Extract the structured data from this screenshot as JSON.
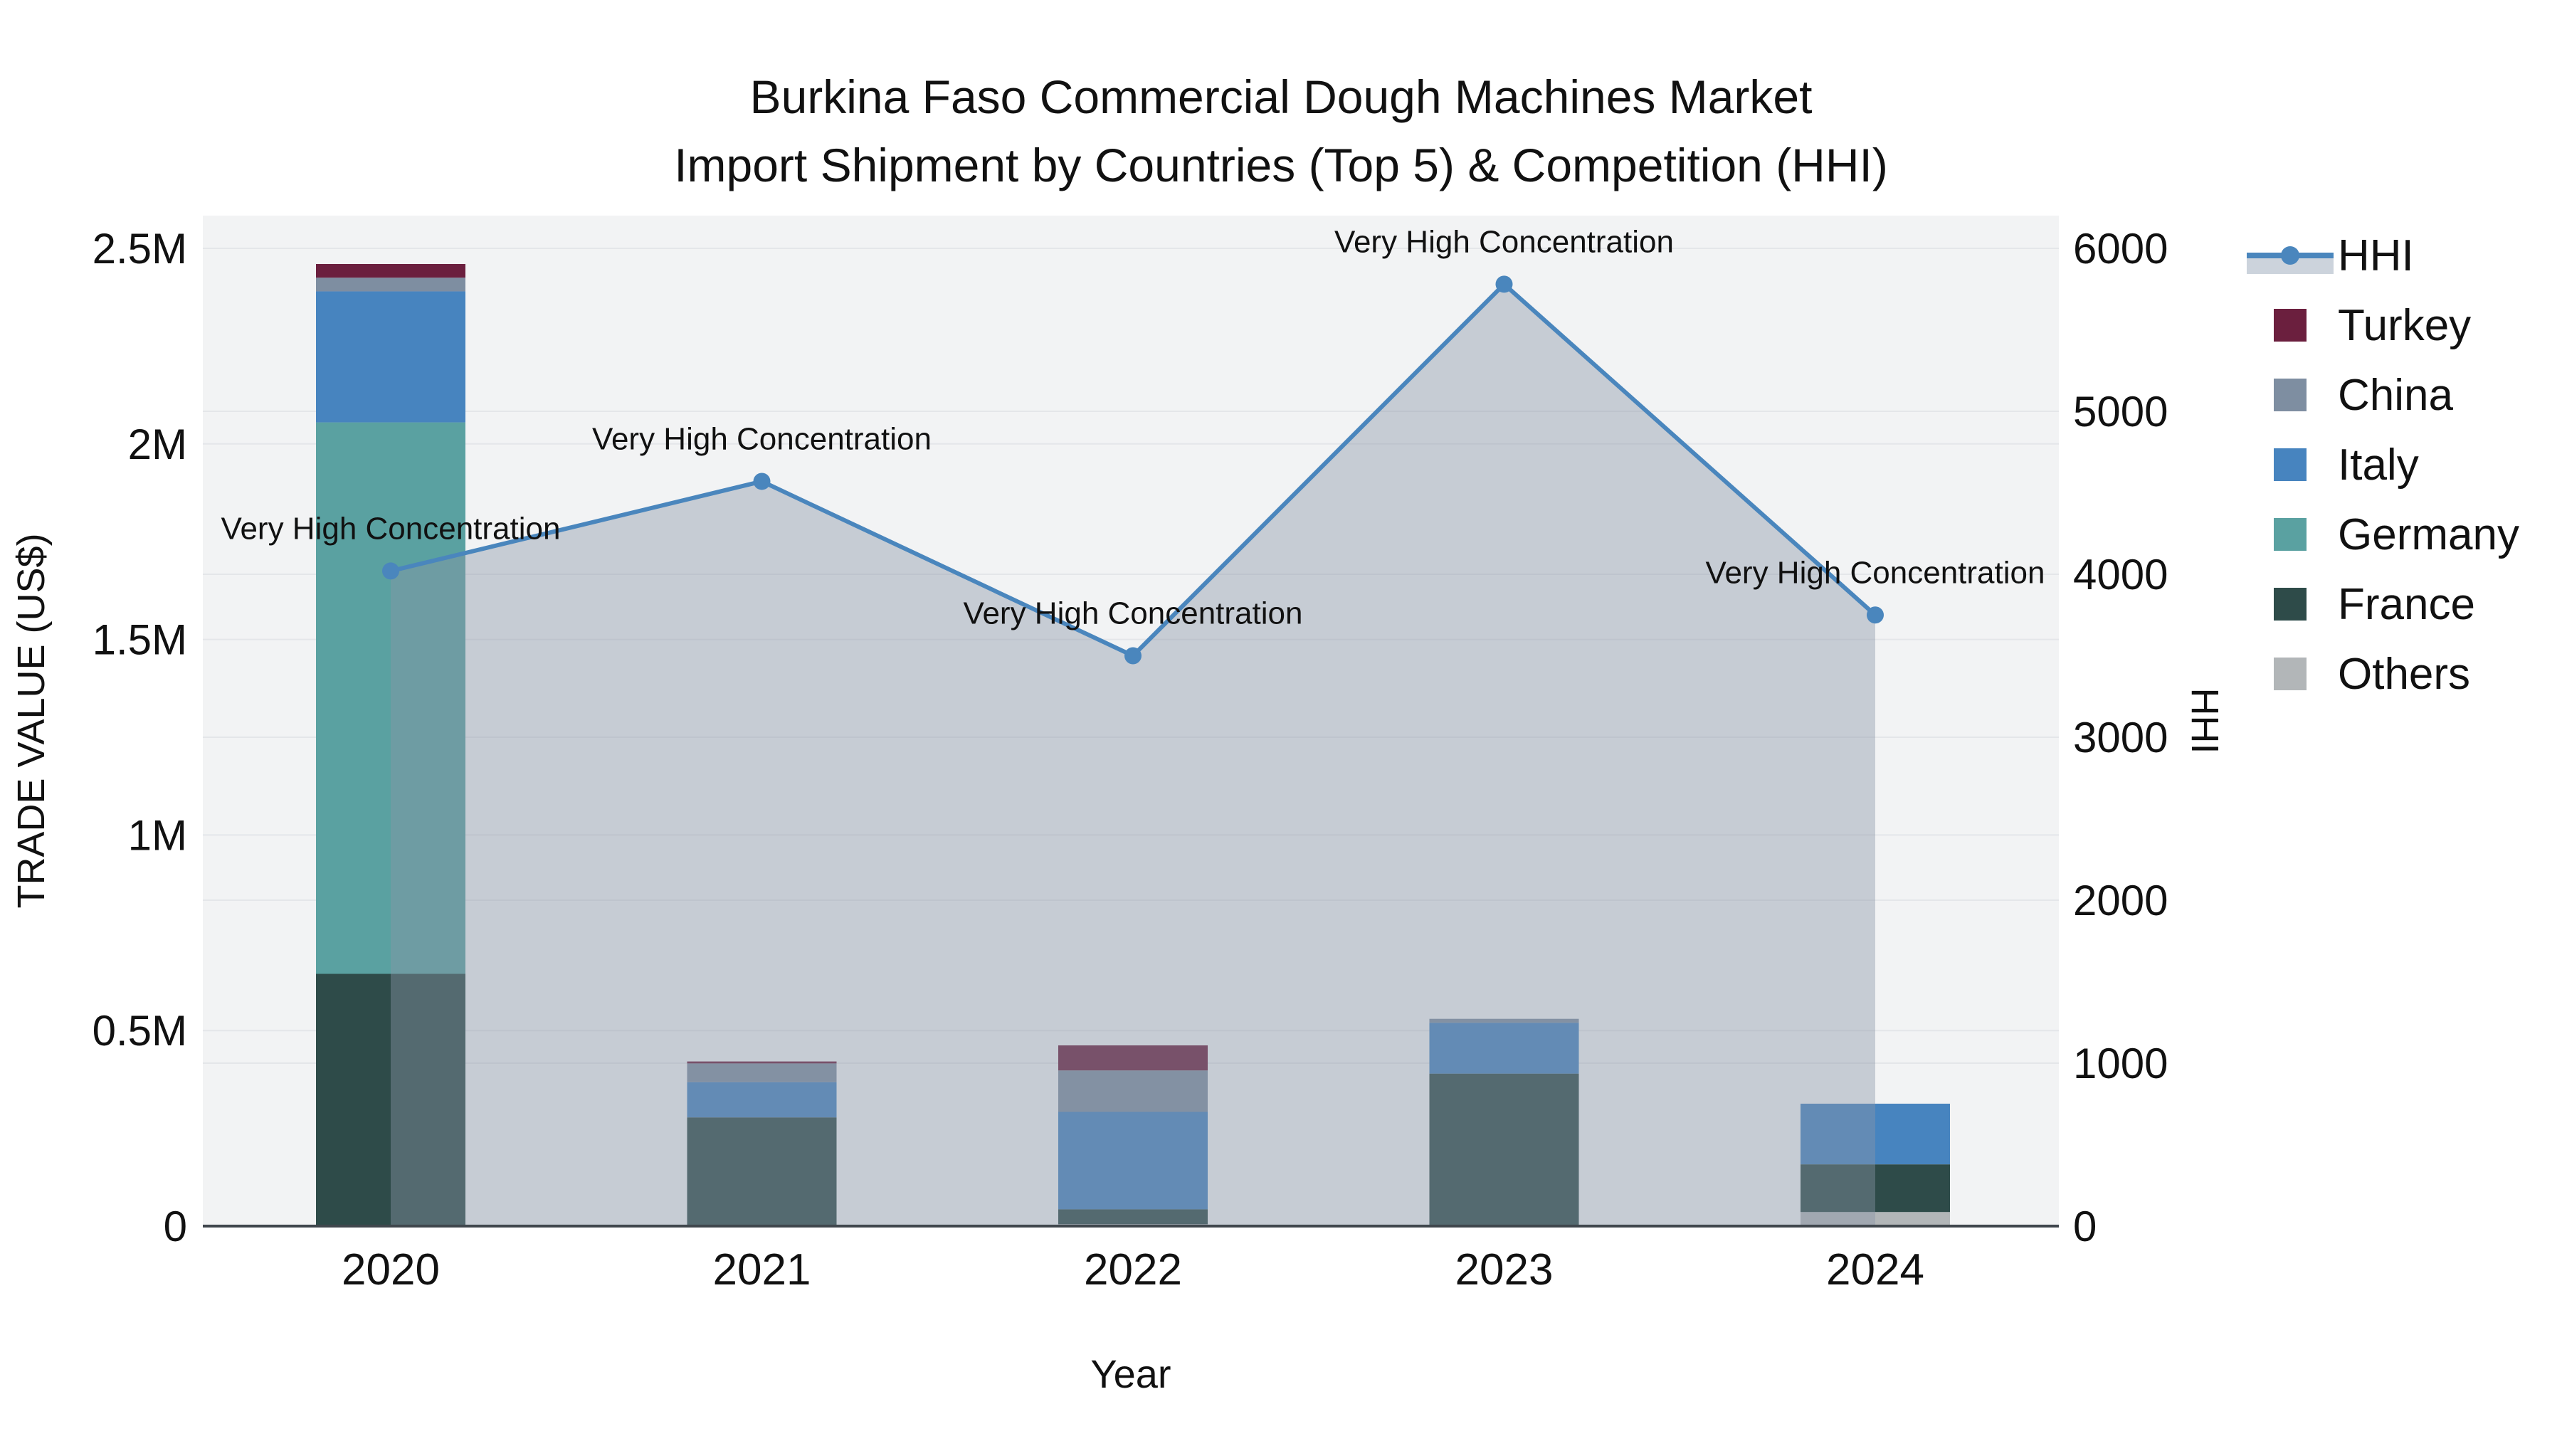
{
  "title": {
    "line1": "Burkina Faso Commercial Dough Machines Market",
    "line2": "Import Shipment by Countries (Top 5) & Competition (HHI)"
  },
  "axes": {
    "x": {
      "title": "Year",
      "tick_labels": [
        "2020",
        "2021",
        "2022",
        "2023",
        "2024"
      ]
    },
    "y_left": {
      "title": "TRADE VALUE (US$)",
      "tick_labels": [
        "0",
        "0.5M",
        "1M",
        "1.5M",
        "2M",
        "2.5M"
      ],
      "range": [
        0,
        2500000
      ]
    },
    "y_right": {
      "title": "HHI",
      "tick_labels": [
        "0",
        "1000",
        "2000",
        "3000",
        "4000",
        "5000",
        "6000"
      ],
      "range": [
        0,
        6000
      ]
    }
  },
  "legend": {
    "items": [
      {
        "label": "HHI",
        "type": "line"
      },
      {
        "label": "Turkey",
        "type": "bar"
      },
      {
        "label": "China",
        "type": "bar"
      },
      {
        "label": "Italy",
        "type": "bar"
      },
      {
        "label": "Germany",
        "type": "bar"
      },
      {
        "label": "France",
        "type": "bar"
      },
      {
        "label": "Others",
        "type": "bar"
      }
    ]
  },
  "colors": {
    "Turkey": "#6b1f3e",
    "China": "#7e8ea1",
    "Italy": "#4784bf",
    "Germany": "#5aa1a1",
    "France": "#2e4b49",
    "Others": "#b2b6b8",
    "hhi_line": "#4a86bd",
    "hhi_fill": "rgba(139,151,167,0.42)",
    "hhi_legend_fill": "#ccd3dc",
    "plot_bg": "#f2f3f4",
    "grid": "#e4e6e9",
    "axis_line": "#3f464c",
    "text": "#111111"
  },
  "chart_data": {
    "type": "bar",
    "subtype": "stacked-bars-with-line-dual-axis",
    "title": "Burkina Faso Commercial Dough Machines Market — Import Shipment by Countries (Top 5) & Competition (HHI)",
    "categories": [
      "2020",
      "2021",
      "2022",
      "2023",
      "2024"
    ],
    "stack_order_bottom_to_top": [
      "Others",
      "France",
      "Germany",
      "Italy",
      "China",
      "Turkey"
    ],
    "series": [
      {
        "name": "Others",
        "axis": "left",
        "values": [
          0,
          0,
          5000,
          0,
          36000
        ]
      },
      {
        "name": "France",
        "axis": "left",
        "values": [
          645000,
          278000,
          38000,
          390000,
          122000
        ]
      },
      {
        "name": "Germany",
        "axis": "left",
        "values": [
          1410000,
          0,
          0,
          0,
          0
        ]
      },
      {
        "name": "Italy",
        "axis": "left",
        "values": [
          335000,
          90000,
          249000,
          130000,
          155000
        ]
      },
      {
        "name": "China",
        "axis": "left",
        "values": [
          35000,
          48000,
          106000,
          10000,
          0
        ]
      },
      {
        "name": "Turkey",
        "axis": "left",
        "values": [
          35000,
          5000,
          64000,
          0,
          0
        ]
      }
    ],
    "bar_totals_approx": [
      2460000,
      421000,
      462000,
      530000,
      313000
    ],
    "line_series": {
      "name": "HHI",
      "axis": "right",
      "values": [
        4020,
        4570,
        3500,
        5780,
        3750
      ]
    },
    "annotations": [
      "Very High Concentration",
      "Very High Concentration",
      "Very High Concentration",
      "Very High Concentration",
      "Very High Concentration"
    ],
    "xlabel": "Year",
    "ylabel_left": "TRADE VALUE (US$)",
    "ylabel_right": "HHI",
    "ylim_left": [
      0,
      2500000
    ],
    "ylim_right": [
      0,
      6000
    ],
    "grid": true,
    "legend_position": "right"
  }
}
